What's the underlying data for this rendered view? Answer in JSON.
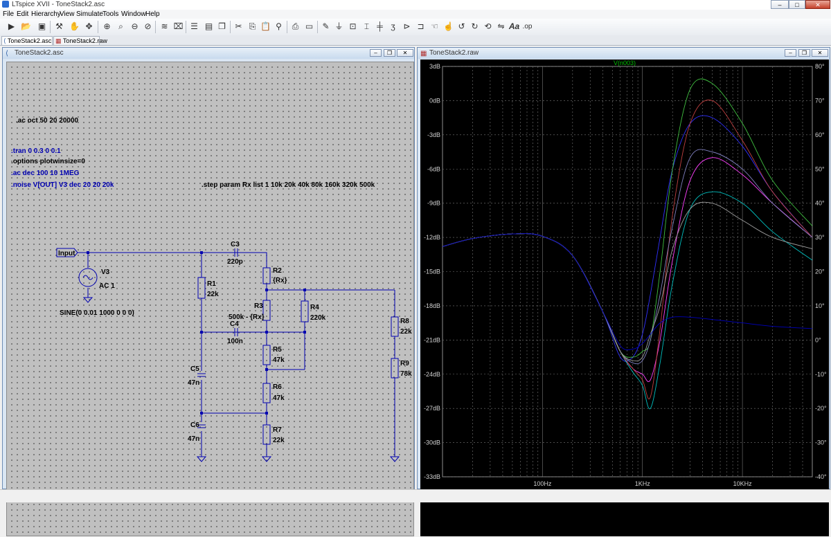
{
  "window": {
    "title": "LTspice XVII - ToneStack2.asc"
  },
  "menu": [
    "File",
    "Edit",
    "Hierarchy",
    "View",
    "Simulate",
    "Tools",
    "Window",
    "Help"
  ],
  "toolbar": {
    "icons": [
      "run-icon",
      "open-icon",
      "save-icon",
      "control-panel-icon",
      "halt-icon",
      "pan-icon",
      "zoom-in-icon",
      "zoom-pan-icon",
      "zoom-out-icon",
      "zoom-fit-icon",
      "autorange-icon",
      "delete-trace-icon",
      "tile-horizontal-icon",
      "tile-vertical-icon",
      "cascade-icon",
      "cut-icon",
      "copy-icon",
      "paste-icon",
      "find-icon",
      "print-icon",
      "print-preview-icon",
      "draw-wire-icon",
      "ground-icon",
      "label-net-icon",
      "resistor-icon",
      "capacitor-icon",
      "inductor-icon",
      "diode-icon",
      "component-icon",
      "move-icon",
      "drag-icon",
      "undo-icon",
      "redo-icon",
      "rotate-icon",
      "mirror-icon",
      "text-icon",
      "spice-directive-icon"
    ]
  },
  "tabs": [
    {
      "label": "ToneStack2.asc",
      "active": true
    },
    {
      "label": "ToneStack2.raw",
      "active": false
    }
  ],
  "schematic": {
    "title": "ToneStack2.asc",
    "directives": [
      {
        "text": ".ac oct 50 20 20000",
        "color": "#000000"
      },
      {
        "text": ".tran 0 0.3 0 0.1",
        "color": "#0000b0"
      },
      {
        "text": ".options plotwinsize=0",
        "color": "#000000"
      },
      {
        "text": ".ac dec 100 10 1MEG",
        "color": "#0000b0"
      },
      {
        "text": ".noise V[OUT] V3 dec 20 20 20k",
        "color": "#0000b0"
      },
      {
        "text": ".step param Rx list 1 10k 20k  40k 80k 160k 320k 500k",
        "color": "#000000"
      }
    ],
    "input_label": "Input",
    "source": {
      "name": "V3",
      "ac": "AC 1",
      "tran": "SINE(0 0.01 1000 0 0 0)"
    },
    "components": [
      {
        "ref": "C3",
        "value": "220p"
      },
      {
        "ref": "R1",
        "value": "22k"
      },
      {
        "ref": "R2",
        "value": "{Rx}"
      },
      {
        "ref": "R3",
        "value": "500k - {Rx}"
      },
      {
        "ref": "R4",
        "value": "220k"
      },
      {
        "ref": "C4",
        "value": "100n"
      },
      {
        "ref": "R5",
        "value": "47k"
      },
      {
        "ref": "C5",
        "value": "47n"
      },
      {
        "ref": "R6",
        "value": "47k"
      },
      {
        "ref": "C6",
        "value": "47n"
      },
      {
        "ref": "R7",
        "value": "22k"
      },
      {
        "ref": "R8",
        "value": "22k"
      },
      {
        "ref": "R9",
        "value": "78k"
      }
    ]
  },
  "plot": {
    "title": "ToneStack2.raw",
    "trace_label": "V(n003)",
    "trace_color": "#00c000"
  },
  "colors": {
    "wire": "#0000b0",
    "component": "#0000b0",
    "grid": "#909090"
  },
  "chart_data": {
    "type": "line",
    "title": "V(n003)",
    "x_scale": "log",
    "xlim": [
      10,
      50000
    ],
    "x_tick_labels": [
      "100Hz",
      "1KHz",
      "10KHz"
    ],
    "ylim_left": [
      -33,
      3
    ],
    "y_left_tick_labels": [
      "3dB",
      "0dB",
      "-3dB",
      "-6dB",
      "-9dB",
      "-12dB",
      "-15dB",
      "-18dB",
      "-21dB",
      "-24dB",
      "-27dB",
      "-30dB",
      "-33dB"
    ],
    "ylim_right": [
      -40,
      80
    ],
    "y_right_tick_labels": [
      "80°",
      "70°",
      "60°",
      "50°",
      "40°",
      "30°",
      "20°",
      "10°",
      "0°",
      "-10°",
      "-20°",
      "-30°",
      "-40°"
    ],
    "grid": true,
    "x": [
      10,
      20,
      50,
      100,
      200,
      400,
      600,
      800,
      1000,
      1200,
      1500,
      2000,
      3000,
      5000,
      10000,
      20000,
      50000
    ],
    "series": [
      {
        "color": "#3030ff",
        "values": [
          -12.8,
          -12.1,
          -11.7,
          -11.9,
          -13.6,
          -18.5,
          -22.5,
          -22.5,
          -20.5,
          -17.0,
          -12.0,
          -6.0,
          -2.0,
          -1.5,
          -4.0,
          -8.0,
          -12.0
        ]
      },
      {
        "color": "#ff40ff",
        "values": [
          -12.8,
          -12.1,
          -11.7,
          -11.9,
          -13.6,
          -18.5,
          -22.0,
          -23.5,
          -24.0,
          -24.5,
          -21.0,
          -14.0,
          -7.0,
          -5.0,
          -6.5,
          -9.0,
          -12.0
        ]
      },
      {
        "color": "#00c0c0",
        "values": [
          -12.8,
          -12.1,
          -11.7,
          -11.9,
          -13.6,
          -18.5,
          -22.0,
          -23.8,
          -25.0,
          -27.0,
          -23.0,
          -16.0,
          -9.5,
          -8.0,
          -9.0,
          -11.5,
          -14.0
        ]
      },
      {
        "color": "#c04040",
        "values": [
          -12.8,
          -12.1,
          -11.7,
          -11.9,
          -13.6,
          -18.5,
          -22.0,
          -23.5,
          -24.5,
          -26.0,
          -20.0,
          -10.0,
          -2.0,
          0.0,
          -3.5,
          -8.0,
          -12.0
        ]
      },
      {
        "color": "#40c040",
        "values": [
          -12.8,
          -12.1,
          -11.7,
          -11.9,
          -13.6,
          -18.5,
          -22.0,
          -22.5,
          -22.0,
          -21.0,
          -15.0,
          -6.0,
          1.0,
          1.5,
          -2.0,
          -7.0,
          -11.0
        ]
      },
      {
        "color": "#8080c0",
        "values": [
          -12.8,
          -12.1,
          -11.7,
          -11.9,
          -13.6,
          -18.5,
          -22.0,
          -23.0,
          -22.8,
          -21.0,
          -17.0,
          -11.0,
          -5.0,
          -4.5,
          -6.0,
          -9.0,
          -12.0
        ]
      },
      {
        "color": "#a0a0a0",
        "values": [
          -12.8,
          -12.1,
          -11.7,
          -11.9,
          -13.6,
          -18.5,
          -22.0,
          -22.8,
          -22.5,
          -20.5,
          -18.0,
          -13.0,
          -9.5,
          -9.0,
          -10.5,
          -12.0,
          -13.0
        ]
      },
      {
        "color": "#0000c0",
        "values": [
          -12.8,
          -12.1,
          -11.7,
          -11.9,
          -13.6,
          -18.5,
          -21.5,
          -21.8,
          -21.3,
          -20.5,
          -19.5,
          -19.0,
          -19.0,
          -19.2,
          -19.5,
          -19.8,
          -20.0
        ]
      }
    ]
  }
}
